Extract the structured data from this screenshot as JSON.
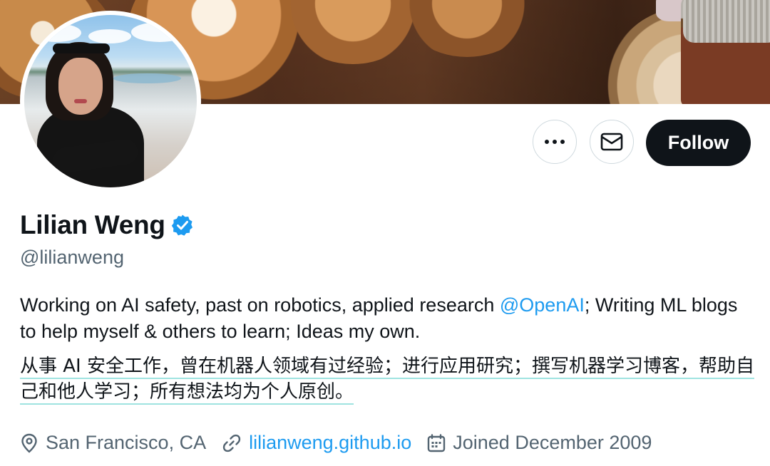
{
  "profile": {
    "name": "Lilian Weng",
    "handle": "@lilianweng",
    "verified_icon": "verified-badge-icon",
    "bio": {
      "part1": "Working on AI safety, past on robotics, applied research ",
      "mention": "@OpenAI",
      "part2": "; Writing ML blogs to help myself & others to learn; Ideas my own."
    },
    "bio_chinese": "从事 AI 安全工作，曾在机器人领域有过经验；进行应用研究；撰写机器学习博客，帮助自己和他人学习；所有想法均为个人原创。",
    "location": "San Francisco, CA",
    "website": "lilianweng.github.io",
    "joined": "Joined December 2009"
  },
  "actions": {
    "more_icon": "more-horizontal-icon",
    "message_icon": "envelope-icon",
    "follow_label": "Follow"
  },
  "colors": {
    "accent": "#1d9bf0",
    "text": "#0f1419",
    "secondary": "#536471",
    "follow_bg": "#0f1419",
    "translation_underline": "#9fe3e0"
  }
}
